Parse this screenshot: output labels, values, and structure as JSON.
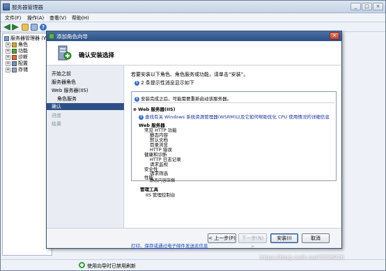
{
  "main_window": {
    "title": "服务器管理器",
    "menu": [
      "文件(F)",
      "操作(A)",
      "查看(V)",
      "帮助(H)"
    ],
    "tree": [
      {
        "label": "服务器管理器 (W",
        "expander": "",
        "depth": 0
      },
      {
        "label": "角色",
        "expander": "+",
        "depth": 1
      },
      {
        "label": "功能",
        "expander": "+",
        "depth": 1
      },
      {
        "label": "诊断",
        "expander": "+",
        "depth": 1
      },
      {
        "label": "配置",
        "expander": "+",
        "depth": 1
      },
      {
        "label": "存储",
        "expander": "+",
        "depth": 1
      }
    ],
    "status_text": "使用向导时已禁用刷新"
  },
  "dialog": {
    "title": "添加角色向导",
    "heading": "确认安装选择",
    "nav": [
      {
        "label": "开始之前",
        "state": "normal"
      },
      {
        "label": "服务器角色",
        "state": "normal"
      },
      {
        "label": "Web 服务器(IIS)",
        "state": "normal"
      },
      {
        "label": "角色服务",
        "state": "normal",
        "indent": true
      },
      {
        "label": "确认",
        "state": "selected"
      },
      {
        "label": "进度",
        "state": "disabled"
      },
      {
        "label": "结果",
        "state": "disabled"
      }
    ],
    "intro": "若要安装以下角色、角色服务或功能，请单击“安装”。",
    "info_count": "2 条提示性消息显示如下",
    "restart_note": "安装完成之后，可能需要重新启动该服务器。",
    "section_title": "Web 服务器(IIS)",
    "srm_note": "查找有关 Windows 系统资源管理器(WSRM)以及它如何帮助优化 CPU 使用情况的详细信息",
    "role_services_title": "Web 服务器",
    "role_services": [
      {
        "label": "常见 HTTP 功能",
        "level": 1
      },
      {
        "label": "静态内容",
        "level": 2
      },
      {
        "label": "默认文档",
        "level": 2
      },
      {
        "label": "目录浏览",
        "level": 2
      },
      {
        "label": "HTTP 错误",
        "level": 2
      },
      {
        "label": "健康和诊断",
        "level": 1
      },
      {
        "label": "HTTP 日志记录",
        "level": 2
      },
      {
        "label": "请求监视",
        "level": 2
      },
      {
        "label": "安全性",
        "level": 1
      },
      {
        "label": "请求筛选",
        "level": 2
      },
      {
        "label": "性能",
        "level": 1
      },
      {
        "label": "静态内容压缩",
        "level": 2
      }
    ],
    "mgmt_title": "管理工具",
    "mgmt_items": [
      "IIS 管理控制台"
    ],
    "link": "打印、保存或通过电子邮件发送此信息",
    "buttons": {
      "prev": "< 上一步(P)",
      "next": "下一步(N) >",
      "install": "安装(I)",
      "cancel": "取消"
    }
  },
  "watermark": "https://blog.csdn.net/5556926",
  "colors": {
    "title_bar": "#2d5187",
    "selection": "#2d5187",
    "link": "#1a44b8",
    "desktop": "#7f93ab"
  }
}
